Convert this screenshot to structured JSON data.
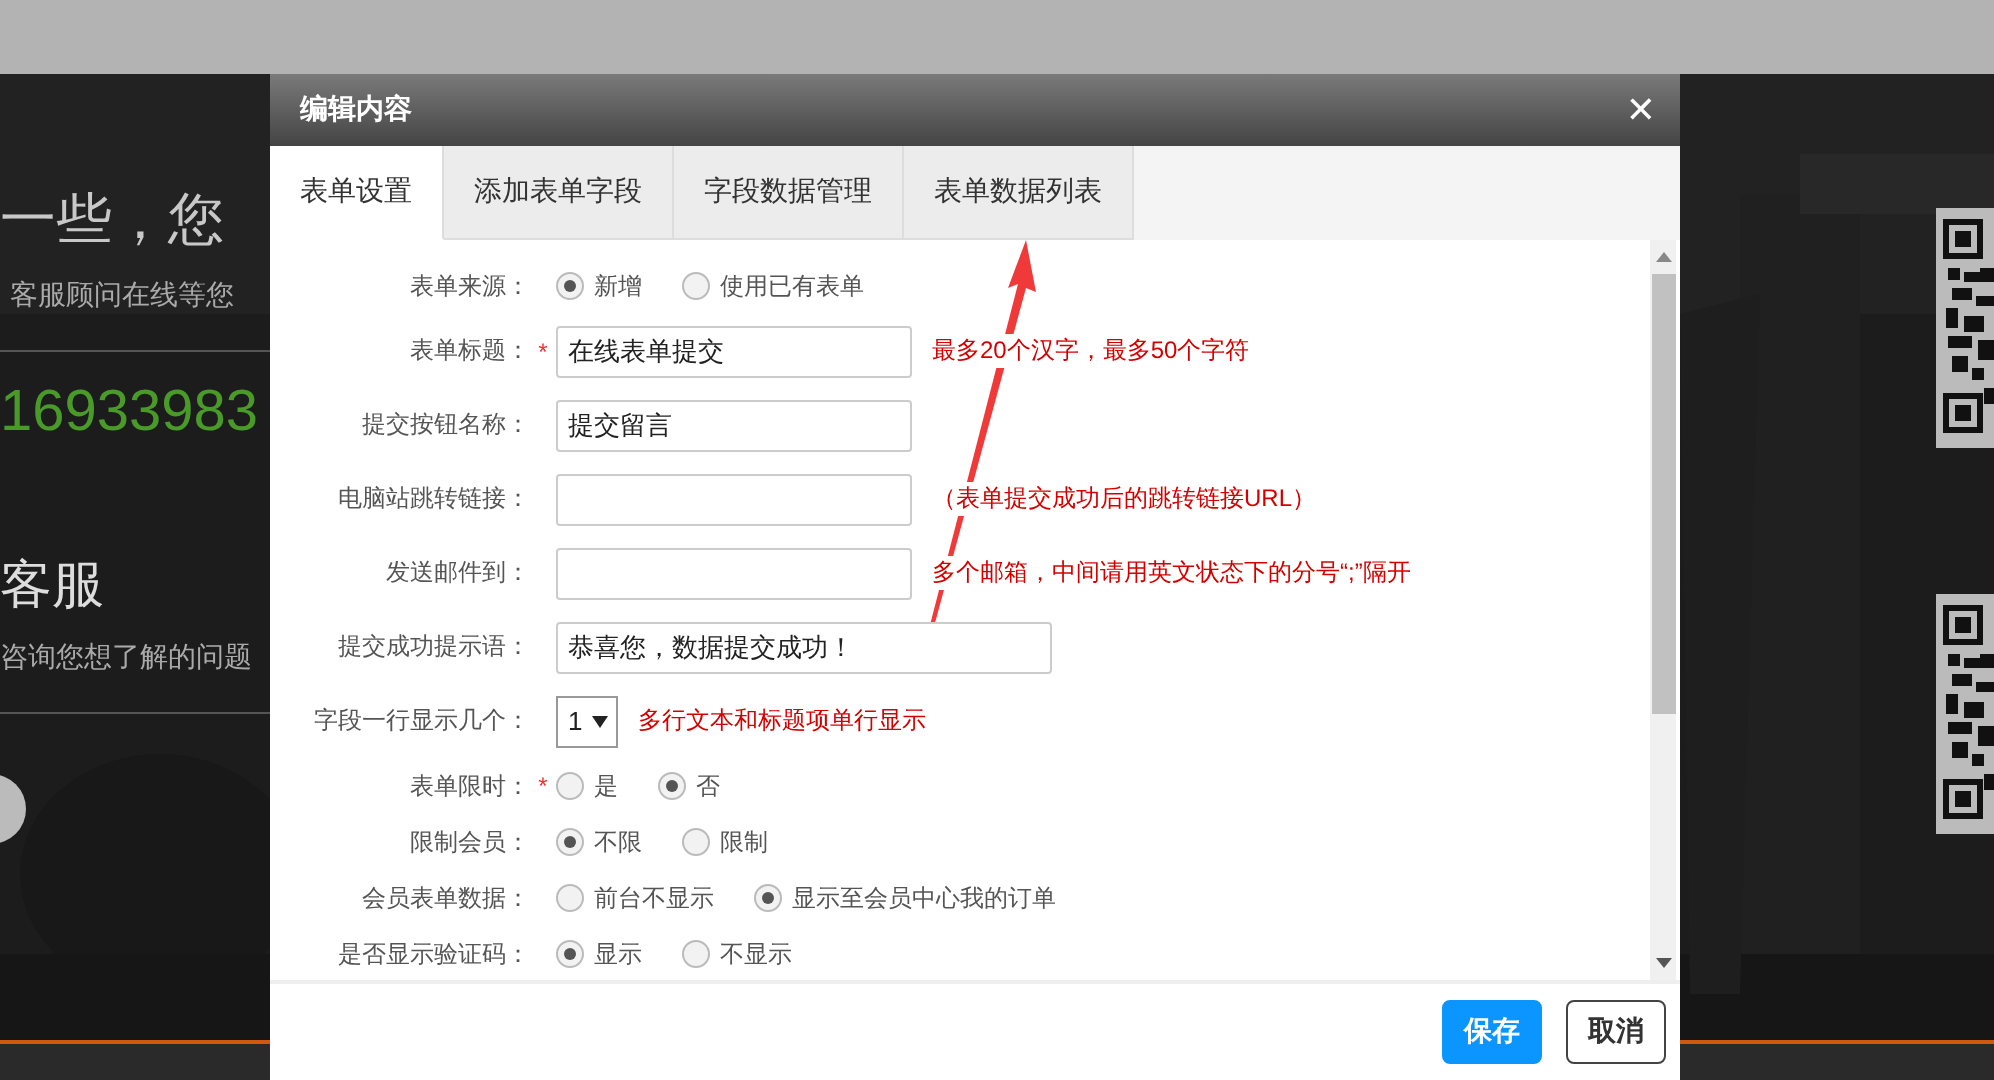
{
  "backdrop": {
    "headline": "一些，您",
    "subline": "客服顾问在线等您",
    "phone": "16933983",
    "service_title": "客服",
    "service_subline": "咨询您想了解的问题"
  },
  "window": {
    "title": "编辑内容",
    "close": "✕"
  },
  "tabs": [
    {
      "label": "表单设置",
      "selected": true
    },
    {
      "label": "添加表单字段",
      "selected": false
    },
    {
      "label": "字段数据管理",
      "selected": false
    },
    {
      "label": "表单数据列表",
      "selected": false
    }
  ],
  "form": {
    "rows": [
      {
        "kind": "radio",
        "label": "表单来源：",
        "options": [
          {
            "label": "新增",
            "selected": true
          },
          {
            "label": "使用已有表单",
            "selected": false
          }
        ]
      },
      {
        "kind": "text",
        "label": "表单标题：",
        "required_mark": "*",
        "value": "在线表单提交",
        "hint": "最多20个汉字，最多50个字符"
      },
      {
        "kind": "text",
        "label": "提交按钮名称：",
        "value": "提交留言"
      },
      {
        "kind": "text",
        "label": "电脑站跳转链接：",
        "hint": "（表单提交成功后的跳转链接URL）"
      },
      {
        "kind": "text",
        "label": "发送邮件到：",
        "hint": "多个邮箱，中间请用英文状态下的分号“;”隔开"
      },
      {
        "kind": "long_text",
        "label": "提交成功提示语：",
        "value": "恭喜您，数据提交成功！"
      },
      {
        "kind": "select",
        "label": "字段一行显示几个：",
        "value": "1",
        "hint": "多行文本和标题项单行显示"
      },
      {
        "kind": "radio",
        "label": "表单限时：",
        "required_mark": "*",
        "options": [
          {
            "label": "是",
            "selected": false
          },
          {
            "label": "否",
            "selected": true
          }
        ]
      },
      {
        "kind": "radio",
        "label": "限制会员：",
        "options": [
          {
            "label": "不限",
            "selected": true
          },
          {
            "label": "限制",
            "selected": false
          }
        ]
      },
      {
        "kind": "radio",
        "label": "会员表单数据：",
        "options": [
          {
            "label": "前台不显示",
            "selected": false
          },
          {
            "label": "显示至会员中心我的订单",
            "selected": true
          }
        ]
      },
      {
        "kind": "radio",
        "label": "是否显示验证码：",
        "options": [
          {
            "label": "显示",
            "selected": true
          },
          {
            "label": "不显示",
            "selected": false
          }
        ]
      }
    ]
  },
  "buttons": [
    {
      "label": "保存",
      "kind": "primary"
    },
    {
      "label": "取消",
      "kind": "secondary"
    }
  ]
}
